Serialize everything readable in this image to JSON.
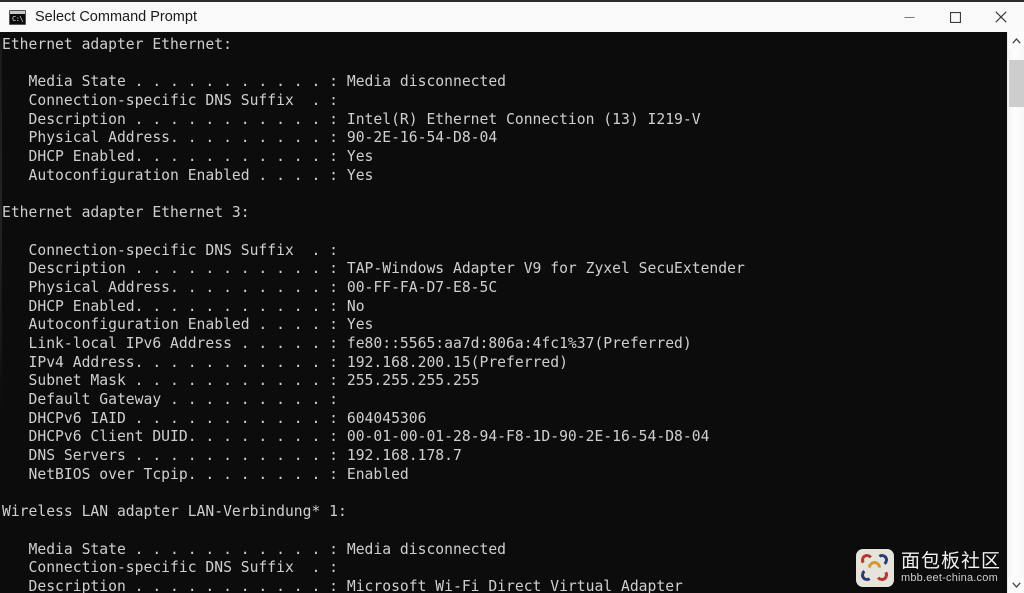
{
  "window": {
    "title": "Select Command Prompt",
    "icon": "cmd-console-icon",
    "prompt_glyph": "C:\\",
    "colors": {
      "titlebar_bg": "#f9f9f9",
      "console_bg": "#0c0c0c",
      "console_fg": "#cfcfcf",
      "scrollbar_thumb": "#cdcdcd"
    },
    "controls": {
      "minimize_label": "Minimize",
      "maximize_label": "Maximize",
      "close_label": "Close"
    }
  },
  "scrollbar": {
    "up_arrow": "ⱏ",
    "down_arrow": "ⱟ",
    "thumb_position_percent": 5
  },
  "console": {
    "command_output_lines": [
      "Ethernet adapter Ethernet:",
      "",
      "   Media State . . . . . . . . . . . : Media disconnected",
      "   Connection-specific DNS Suffix  . :",
      "   Description . . . . . . . . . . . : Intel(R) Ethernet Connection (13) I219-V",
      "   Physical Address. . . . . . . . . : 90-2E-16-54-D8-04",
      "   DHCP Enabled. . . . . . . . . . . : Yes",
      "   Autoconfiguration Enabled . . . . : Yes",
      "",
      "Ethernet adapter Ethernet 3:",
      "",
      "   Connection-specific DNS Suffix  . :",
      "   Description . . . . . . . . . . . : TAP-Windows Adapter V9 for Zyxel SecuExtender",
      "   Physical Address. . . . . . . . . : 00-FF-FA-D7-E8-5C",
      "   DHCP Enabled. . . . . . . . . . . : No",
      "   Autoconfiguration Enabled . . . . : Yes",
      "   Link-local IPv6 Address . . . . . : fe80::5565:aa7d:806a:4fc1%37(Preferred)",
      "   IPv4 Address. . . . . . . . . . . : 192.168.200.15(Preferred)",
      "   Subnet Mask . . . . . . . . . . . : 255.255.255.255",
      "   Default Gateway . . . . . . . . . :",
      "   DHCPv6 IAID . . . . . . . . . . . : 604045306",
      "   DHCPv6 Client DUID. . . . . . . . : 00-01-00-01-28-94-F8-1D-90-2E-16-54-D8-04",
      "   DNS Servers . . . . . . . . . . . : 192.168.178.7",
      "   NetBIOS over Tcpip. . . . . . . . : Enabled",
      "",
      "Wireless LAN adapter LAN-Verbindung* 1:",
      "",
      "   Media State . . . . . . . . . . . : Media disconnected",
      "   Connection-specific DNS Suffix  . :",
      "   Description . . . . . . . . . . . : Microsoft Wi-Fi Direct Virtual Adapter"
    ],
    "adapters": [
      {
        "name": "Ethernet adapter Ethernet:",
        "fields": [
          {
            "label": "Media State",
            "value": "Media disconnected"
          },
          {
            "label": "Connection-specific DNS Suffix",
            "value": ""
          },
          {
            "label": "Description",
            "value": "Intel(R) Ethernet Connection (13) I219-V"
          },
          {
            "label": "Physical Address",
            "value": "90-2E-16-54-D8-04"
          },
          {
            "label": "DHCP Enabled",
            "value": "Yes"
          },
          {
            "label": "Autoconfiguration Enabled",
            "value": "Yes"
          }
        ]
      },
      {
        "name": "Ethernet adapter Ethernet 3:",
        "fields": [
          {
            "label": "Connection-specific DNS Suffix",
            "value": ""
          },
          {
            "label": "Description",
            "value": "TAP-Windows Adapter V9 for Zyxel SecuExtender"
          },
          {
            "label": "Physical Address",
            "value": "00-FF-FA-D7-E8-5C"
          },
          {
            "label": "DHCP Enabled",
            "value": "No"
          },
          {
            "label": "Autoconfiguration Enabled",
            "value": "Yes"
          },
          {
            "label": "Link-local IPv6 Address",
            "value": "fe80::5565:aa7d:806a:4fc1%37(Preferred)"
          },
          {
            "label": "IPv4 Address",
            "value": "192.168.200.15(Preferred)"
          },
          {
            "label": "Subnet Mask",
            "value": "255.255.255.255"
          },
          {
            "label": "Default Gateway",
            "value": ""
          },
          {
            "label": "DHCPv6 IAID",
            "value": "604045306"
          },
          {
            "label": "DHCPv6 Client DUID",
            "value": "00-01-00-01-28-94-F8-1D-90-2E-16-54-D8-04"
          },
          {
            "label": "DNS Servers",
            "value": "192.168.178.7"
          },
          {
            "label": "NetBIOS over Tcpip",
            "value": "Enabled"
          }
        ]
      },
      {
        "name": "Wireless LAN adapter LAN-Verbindung* 1:",
        "fields": [
          {
            "label": "Media State",
            "value": "Media disconnected"
          },
          {
            "label": "Connection-specific DNS Suffix",
            "value": ""
          },
          {
            "label": "Description",
            "value": "Microsoft Wi-Fi Direct Virtual Adapter"
          }
        ]
      }
    ]
  },
  "watermark": {
    "site_name": "面包板社区",
    "url": "mbb.eet-china.com"
  }
}
